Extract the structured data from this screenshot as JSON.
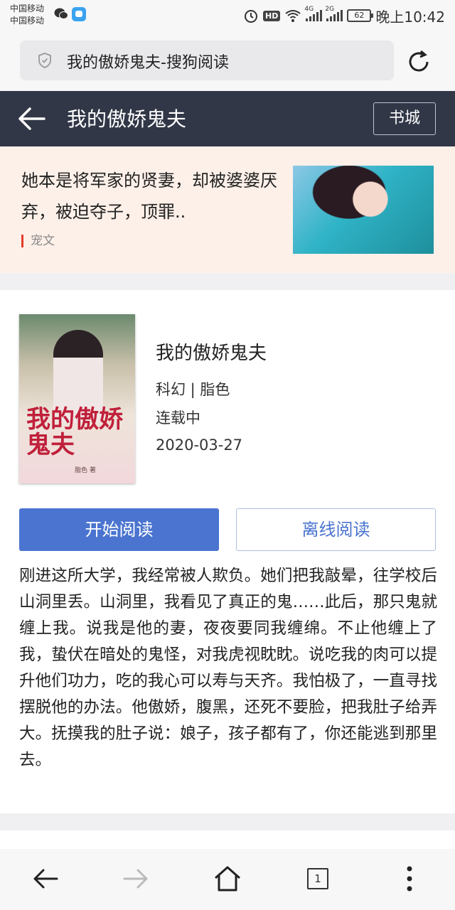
{
  "status_bar": {
    "carrier_1": "中国移动",
    "carrier_2": "中国移动",
    "hd": "HD",
    "net_1": "4G",
    "net_2": "2G",
    "battery": "62",
    "time": "晚上10:42"
  },
  "address_bar": {
    "url_text": "我的傲娇鬼夫-搜狗阅读"
  },
  "header": {
    "title": "我的傲娇鬼夫",
    "bookstore_label": "书城"
  },
  "ad": {
    "text": "她本是将军家的贤妻，却被婆婆厌弃，被迫夺子，顶罪..",
    "tag": "宠文"
  },
  "book": {
    "cover_title": "我的傲娇鬼夫",
    "cover_author": "脂色 著",
    "title": "我的傲娇鬼夫",
    "genre_author": "科幻 | 脂色",
    "status": "连载中",
    "date": "2020-03-27",
    "start_reading_label": "开始阅读",
    "offline_reading_label": "离线阅读",
    "synopsis": "刚进这所大学，我经常被人欺负。她们把我敲晕，往学校后山洞里丢。山洞里，我看见了真正的鬼……此后，那只鬼就缠上我。说我是他的妻，夜夜要同我缠绵。不止他缠上了我，蛰伏在暗处的鬼怪，对我虎视眈眈。说吃我的肉可以提升他们功力，吃的我心可以寿与天齐。我怕极了，一直寻找摆脱他的办法。他傲娇，腹黑，还死不要脸，把我肚子给弄大。抚摸我的肚子说：娘子，孩子都有了，你还能逃到那里去。"
  },
  "bottom_nav": {
    "tab_count": "1"
  },
  "colors": {
    "header_bg": "#313747",
    "accent_blue": "#4a74cf",
    "ad_bg": "#fdf0e9",
    "tag_red": "#e23c2c"
  }
}
